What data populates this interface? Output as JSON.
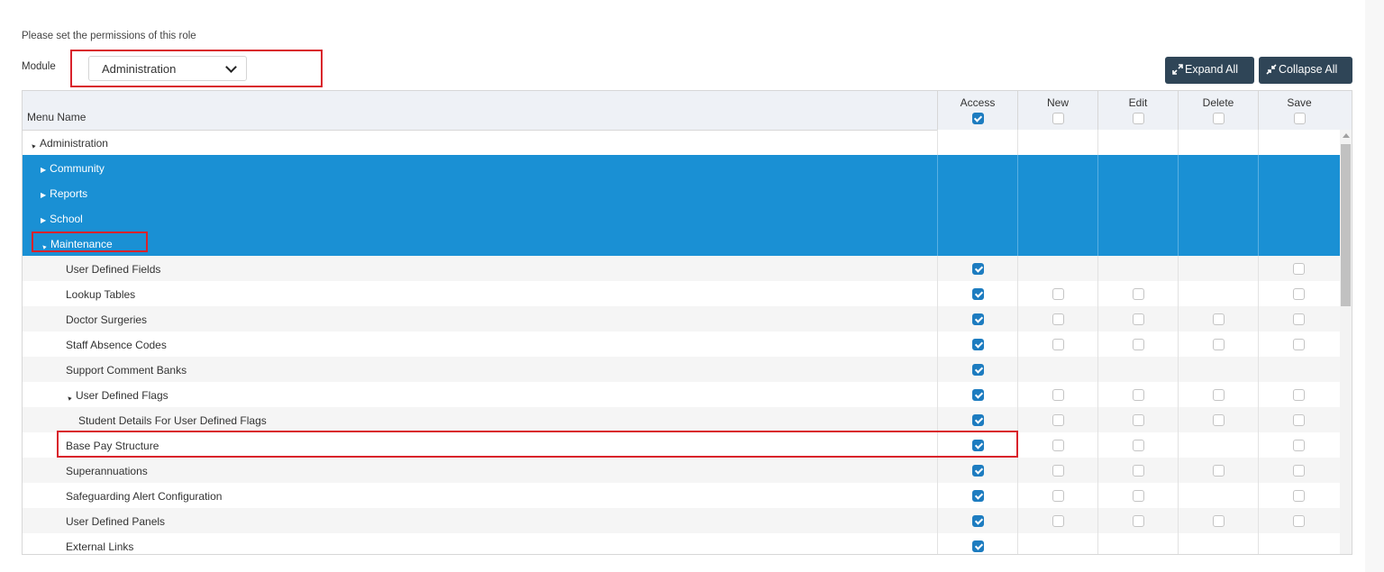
{
  "intro_text": "Please set the permissions of this role",
  "module": {
    "label": "Module",
    "selected": "Administration"
  },
  "buttons": {
    "expand_all": "Expand All",
    "collapse_all": "Collapse All"
  },
  "grid": {
    "menu_name_header": "Menu Name",
    "columns": [
      {
        "label": "Access",
        "header_checked": true
      },
      {
        "label": "New",
        "header_checked": false
      },
      {
        "label": "Edit",
        "header_checked": false
      },
      {
        "label": "Delete",
        "header_checked": false
      },
      {
        "label": "Save",
        "header_checked": false
      }
    ],
    "rows": [
      {
        "label": "Administration",
        "expander": "▲",
        "depth": 0,
        "style": "plain",
        "cells": [
          null,
          null,
          null,
          null,
          null
        ]
      },
      {
        "label": "Community",
        "expander": "▶",
        "depth": 1,
        "style": "selected",
        "cells": [
          null,
          null,
          null,
          null,
          null
        ]
      },
      {
        "label": "Reports",
        "expander": "▶",
        "depth": 1,
        "style": "selected",
        "cells": [
          null,
          null,
          null,
          null,
          null
        ]
      },
      {
        "label": "School",
        "expander": "▶",
        "depth": 1,
        "style": "selected",
        "cells": [
          null,
          null,
          null,
          null,
          null
        ]
      },
      {
        "label": "Maintenance",
        "expander": "▲",
        "depth": 1,
        "style": "selected",
        "cells": [
          null,
          null,
          null,
          null,
          null
        ]
      },
      {
        "label": "User Defined Fields",
        "expander": "",
        "depth": 2,
        "style": "alt",
        "cells": [
          true,
          null,
          null,
          null,
          false
        ]
      },
      {
        "label": "Lookup Tables",
        "expander": "",
        "depth": 2,
        "style": "plain",
        "cells": [
          true,
          false,
          false,
          null,
          false
        ]
      },
      {
        "label": "Doctor Surgeries",
        "expander": "",
        "depth": 2,
        "style": "alt",
        "cells": [
          true,
          false,
          false,
          false,
          false
        ]
      },
      {
        "label": "Staff Absence Codes",
        "expander": "",
        "depth": 2,
        "style": "plain",
        "cells": [
          true,
          false,
          false,
          false,
          false
        ]
      },
      {
        "label": "Support Comment Banks",
        "expander": "",
        "depth": 2,
        "style": "alt",
        "cells": [
          true,
          null,
          null,
          null,
          null
        ]
      },
      {
        "label": "User Defined Flags",
        "expander": "▲",
        "depth": 2,
        "style": "plain",
        "cells": [
          true,
          false,
          false,
          false,
          false
        ]
      },
      {
        "label": "Student Details For User Defined Flags",
        "expander": "",
        "depth": 3,
        "style": "alt",
        "cells": [
          true,
          false,
          false,
          false,
          false
        ]
      },
      {
        "label": "Base Pay Structure",
        "expander": "",
        "depth": 2,
        "style": "plain",
        "cells": [
          true,
          false,
          false,
          null,
          false
        ]
      },
      {
        "label": "Superannuations",
        "expander": "",
        "depth": 2,
        "style": "alt",
        "cells": [
          true,
          false,
          false,
          false,
          false
        ]
      },
      {
        "label": "Safeguarding Alert Configuration",
        "expander": "",
        "depth": 2,
        "style": "plain",
        "cells": [
          true,
          false,
          false,
          null,
          false
        ]
      },
      {
        "label": "User Defined Panels",
        "expander": "",
        "depth": 2,
        "style": "alt",
        "cells": [
          true,
          false,
          false,
          false,
          false
        ]
      },
      {
        "label": "External Links",
        "expander": "",
        "depth": 2,
        "style": "plain",
        "cells": [
          true,
          null,
          null,
          null,
          null
        ]
      }
    ]
  },
  "colors": {
    "selected_row": "#1a90d4",
    "checkbox_checked": "#1d7cc0",
    "button_bg": "#2f4557",
    "highlight": "#d9222b"
  }
}
